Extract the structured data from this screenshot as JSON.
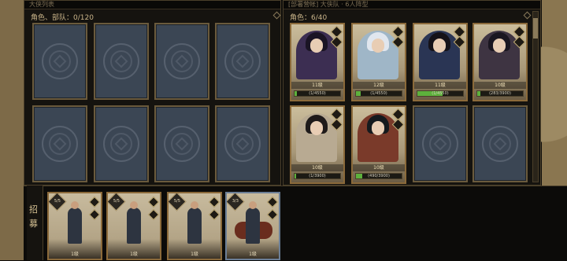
{
  "left_panel": {
    "header": "大侠列表",
    "count_label": "角色、部队：0/120"
  },
  "right_panel": {
    "header": "[部署营帐] 大侠队 · 6人阵型",
    "count_label": "角色：6/40",
    "cards": [
      {
        "level": "11级",
        "bar_text": "(1/4550)",
        "progress": 0.05,
        "art_color": "#3c2e52",
        "hair": "#1a1424"
      },
      {
        "level": "12级",
        "bar_text": "(1/4550)",
        "progress": 0.1,
        "art_color": "#9fb6c7",
        "hair": "#e0e6ee"
      },
      {
        "level": "11级",
        "bar_text": "(1/4550)",
        "progress": 0.55,
        "art_color": "#2a3554",
        "hair": "#151218"
      },
      {
        "level": "10级",
        "bar_text": "(283/3900)",
        "progress": 0.07,
        "art_color": "#3e3442",
        "hair": "#1a1620"
      },
      {
        "level": "10级",
        "bar_text": "(1/3900)",
        "progress": 0.03,
        "art_color": "#b8aa92",
        "hair": "#1e1a1a"
      },
      {
        "level": "10级",
        "bar_text": "(490/3900)",
        "progress": 0.13,
        "art_color": "#7a3a2a",
        "hair": "#151a1e"
      }
    ]
  },
  "recruit": {
    "tab_label_1": "招",
    "tab_label_2": "募",
    "cards": [
      {
        "count": "5/5",
        "level": "1级",
        "type": "infantry"
      },
      {
        "count": "5/5",
        "level": "1级",
        "type": "infantry"
      },
      {
        "count": "5/5",
        "level": "1级",
        "type": "infantry"
      },
      {
        "count": "3/3",
        "level": "1级",
        "type": "cavalry"
      }
    ]
  }
}
